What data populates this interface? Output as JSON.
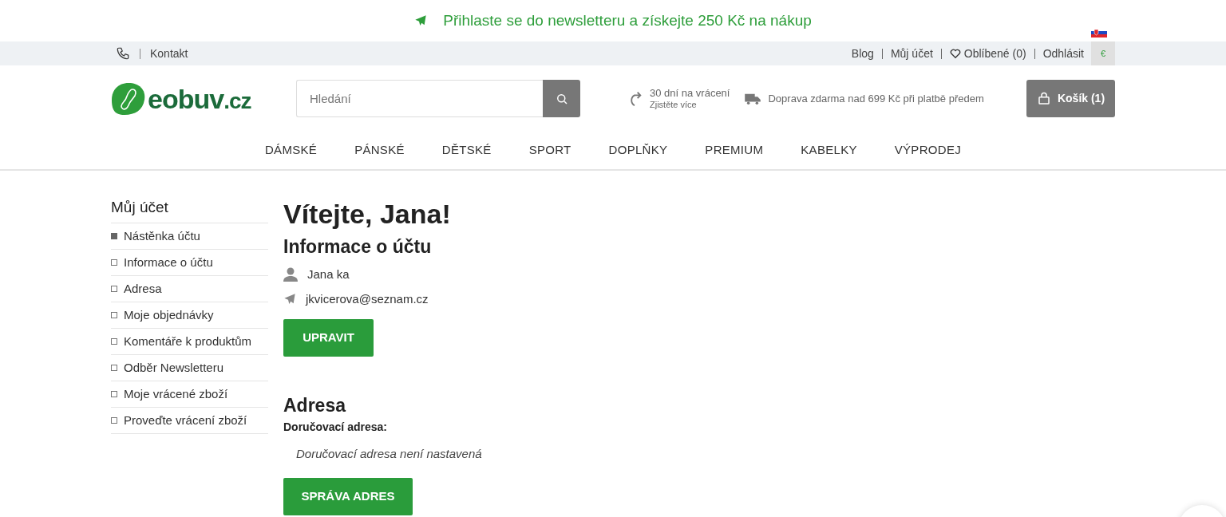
{
  "promo_banner": {
    "text": "Přihlaste se do newsletteru a získejte 250 Kč na nákup"
  },
  "top_bar": {
    "contact": "Kontakt",
    "links": [
      {
        "label": "Blog",
        "kind": "link"
      },
      {
        "label": "Můj účet",
        "kind": "link"
      },
      {
        "label": "Oblíbené (0)",
        "kind": "favorites"
      },
      {
        "label": "Odhlásit",
        "kind": "link"
      }
    ],
    "currency": "€"
  },
  "header": {
    "logo": {
      "name": "eobuv",
      "tld": ".cz"
    },
    "search": {
      "placeholder": "Hledání"
    },
    "returns": {
      "title": "30 dní na vrácení",
      "link": "Zjistěte více"
    },
    "shipping": "Doprava zdarma nad 699 Kč při platbě předem",
    "cart": "Košík (1)"
  },
  "nav": [
    "DÁMSKÉ",
    "PÁNSKÉ",
    "DĚTSKÉ",
    "SPORT",
    "DOPLŇKY",
    "PREMIUM",
    "KABELKY",
    "VÝPRODEJ"
  ],
  "sidebar": {
    "title": "Můj účet",
    "items": [
      {
        "label": "Nástěnka účtu",
        "selected": true
      },
      {
        "label": "Informace o účtu",
        "selected": false
      },
      {
        "label": "Adresa",
        "selected": false
      },
      {
        "label": "Moje objednávky",
        "selected": false
      },
      {
        "label": "Komentáře k produktům",
        "selected": false
      },
      {
        "label": "Odběr Newsletteru",
        "selected": false
      },
      {
        "label": "Moje vrácené zboží",
        "selected": false
      },
      {
        "label": "Proveďte vrácení zboží",
        "selected": false
      }
    ]
  },
  "main": {
    "welcome": "Vítejte, Jana!",
    "account_info": {
      "title": "Informace o účtu",
      "name": "Jana ka",
      "email": "jkvicerova@seznam.cz",
      "button": "UPRAVIT"
    },
    "address": {
      "title": "Adresa",
      "label": "Doručovací adresa:",
      "note": "Doručovací adresa není nastavená",
      "button": "SPRÁVA ADRES"
    }
  }
}
